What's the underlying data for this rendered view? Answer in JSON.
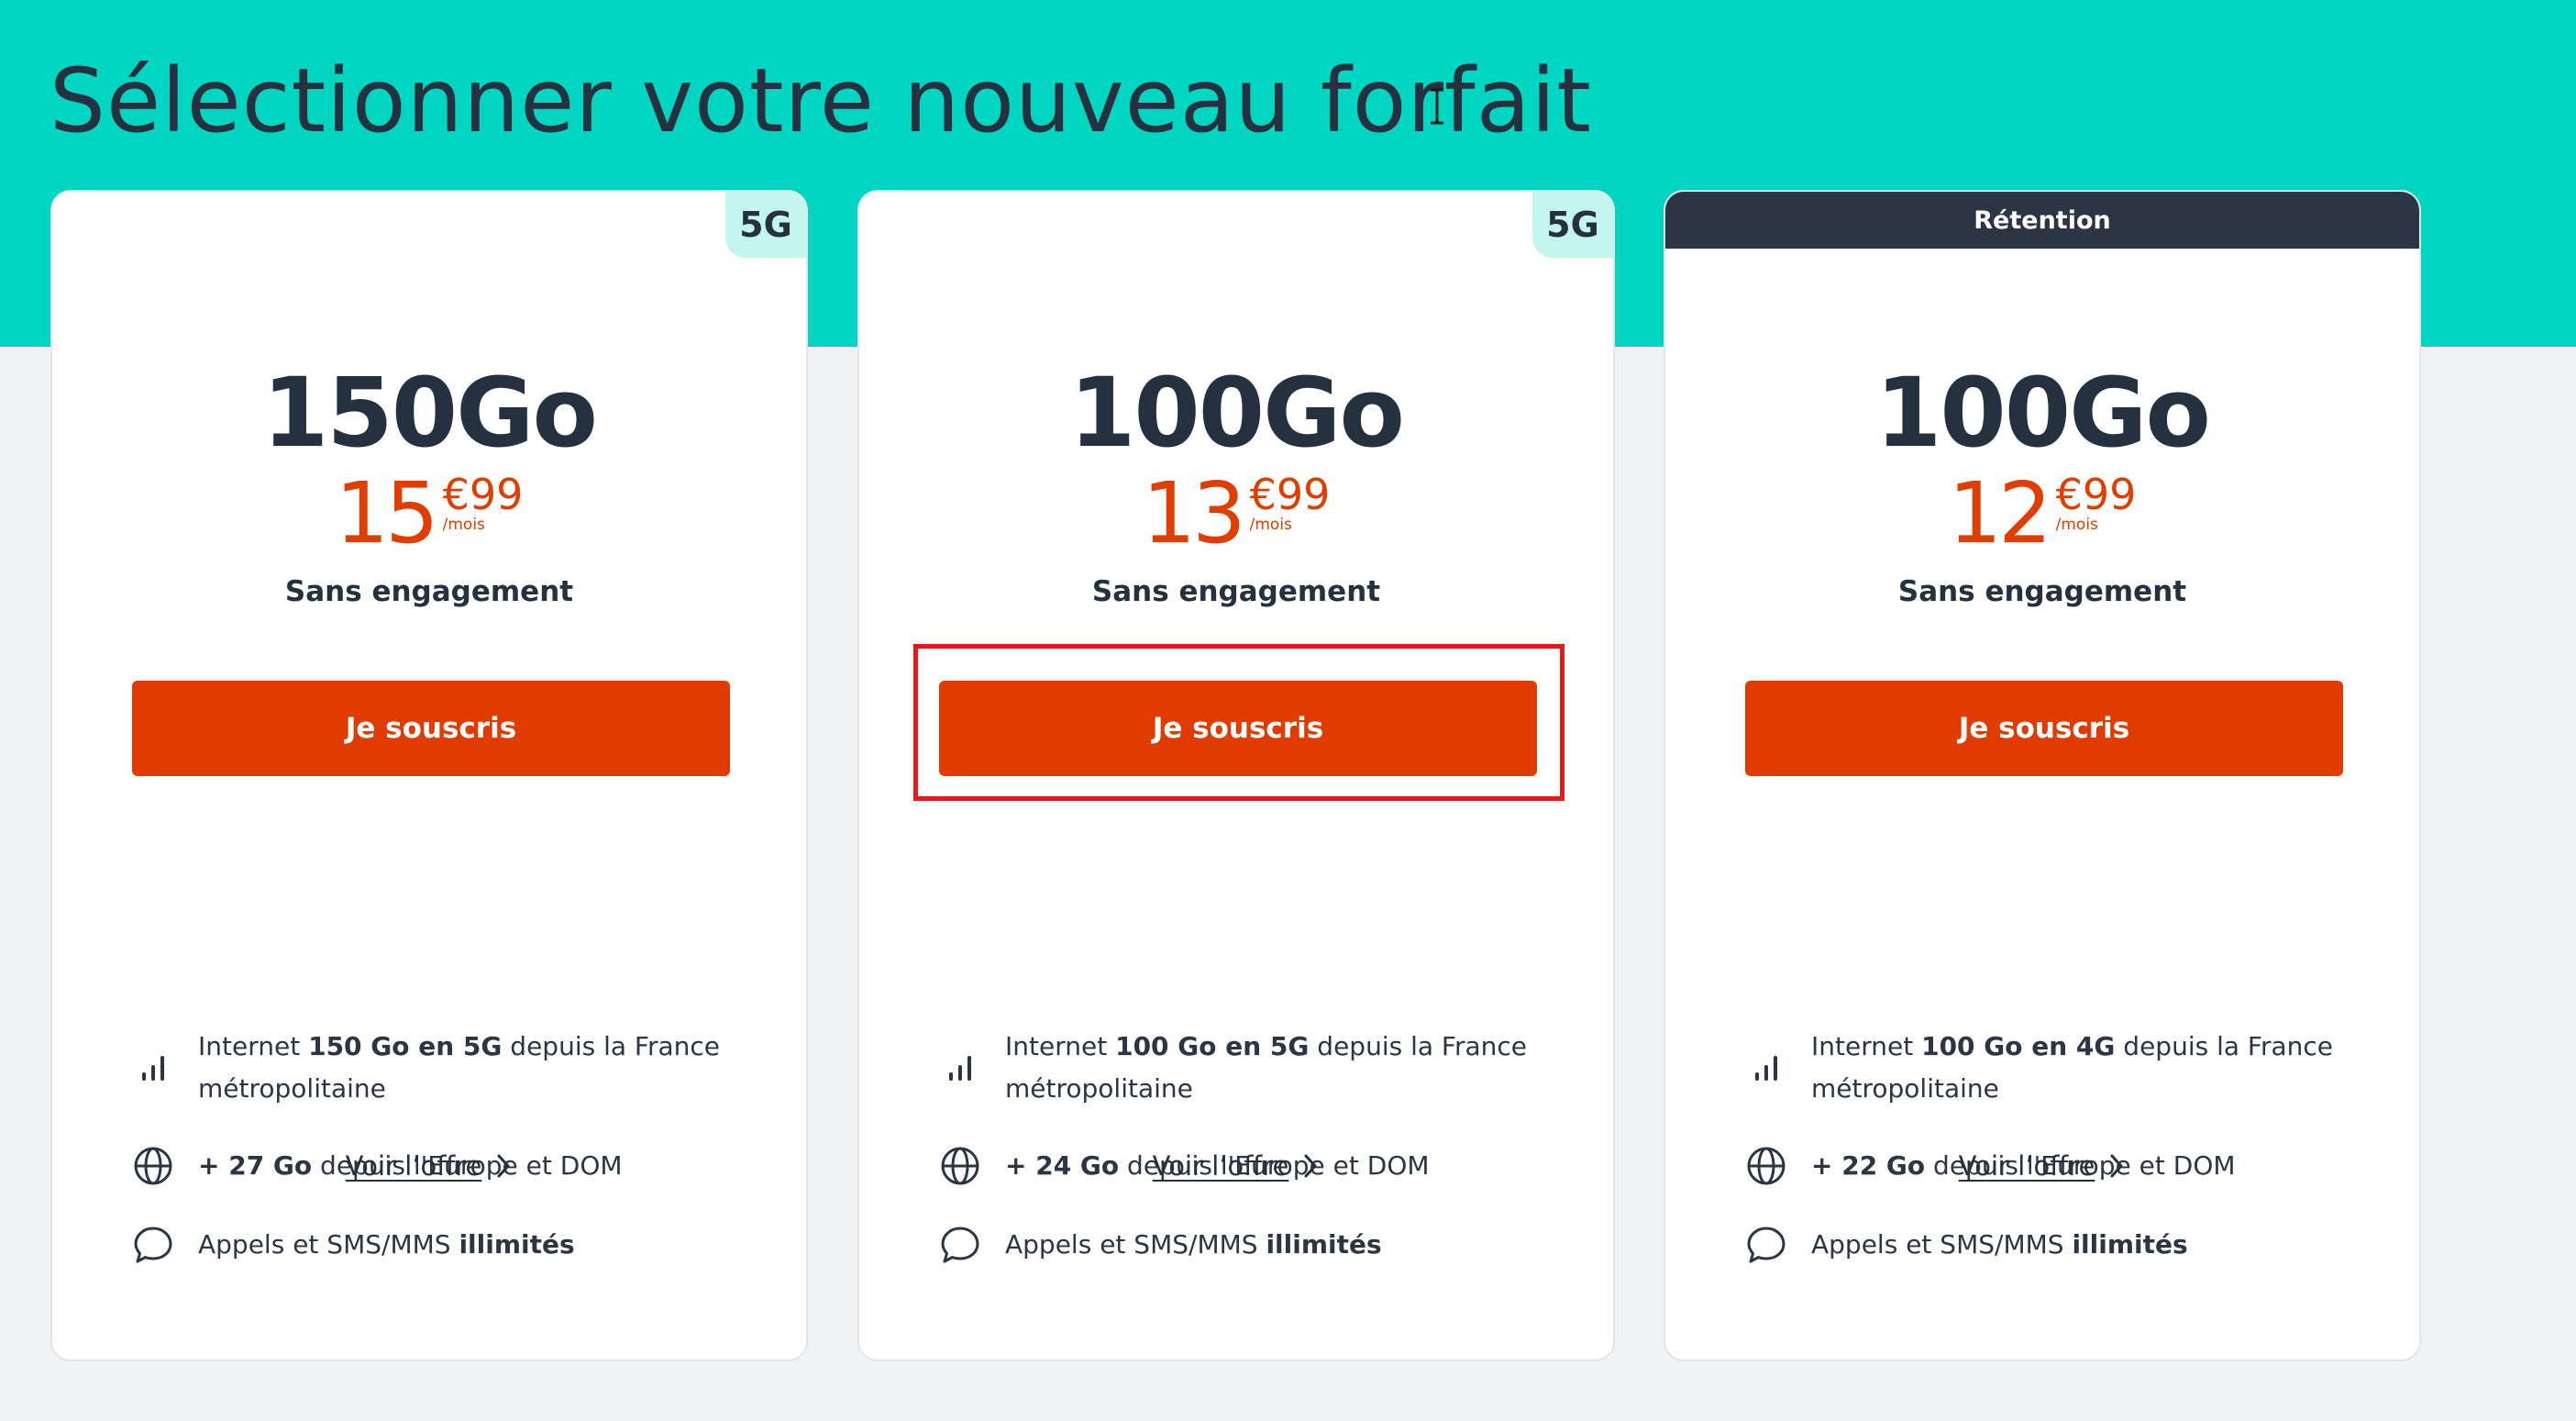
{
  "page": {
    "title": "Sélectionner votre nouveau forfait"
  },
  "colors": {
    "hero_background": "#00d5c2",
    "accent_orange": "#e03b00",
    "dark_navy": "#263140",
    "badge_5g_background": "#c4f6f0",
    "highlight_outline": "#e11a1a"
  },
  "plans": [
    {
      "badge": "5G",
      "data_amount": "150Go",
      "price_int": "15",
      "price_dec": "€99",
      "price_unit": "/mois",
      "commitment": "Sans engagement",
      "cta_label": "Je souscris",
      "features": {
        "f1": {
          "a": "Internet ",
          "b": "150 Go en 5G",
          "c": " depuis la France",
          "d": "métropolitaine"
        },
        "f2": {
          "a": "+ 27 Go",
          "b": " depuis l'Europe et DOM"
        },
        "f3": {
          "a": "Appels et SMS/MMS ",
          "b": "illimités"
        }
      },
      "link_label": "Voir l’offre"
    },
    {
      "badge": "5G",
      "data_amount": "100Go",
      "price_int": "13",
      "price_dec": "€99",
      "price_unit": "/mois",
      "commitment": "Sans engagement",
      "cta_label": "Je souscris",
      "features": {
        "f1": {
          "a": "Internet ",
          "b": "100 Go en 5G",
          "c": " depuis la France",
          "d": "métropolitaine"
        },
        "f2": {
          "a": "+ 24 Go",
          "b": " depuis l'Europe et DOM"
        },
        "f3": {
          "a": "Appels et SMS/MMS ",
          "b": "illimités"
        }
      },
      "link_label": "Voir l’offre"
    },
    {
      "ribbon": "Rétention",
      "data_amount": "100Go",
      "price_int": "12",
      "price_dec": "€99",
      "price_unit": "/mois",
      "commitment": "Sans engagement",
      "cta_label": "Je souscris",
      "features": {
        "f1": {
          "a": "Internet ",
          "b": "100 Go en 4G",
          "c": " depuis la France",
          "d": "métropolitaine"
        },
        "f2": {
          "a": "+ 22 Go",
          "b": " depuis l'Europe et DOM"
        },
        "f3": {
          "a": "Appels et SMS/MMS ",
          "b": "illimités"
        }
      },
      "link_label": "Voir l’offre"
    }
  ],
  "icons": {
    "feature_1": "signal-bars-icon",
    "feature_2": "globe-icon",
    "feature_3": "chat-bubble-icon",
    "link": "chevron-right-icon",
    "pointer": "text-cursor-icon"
  }
}
